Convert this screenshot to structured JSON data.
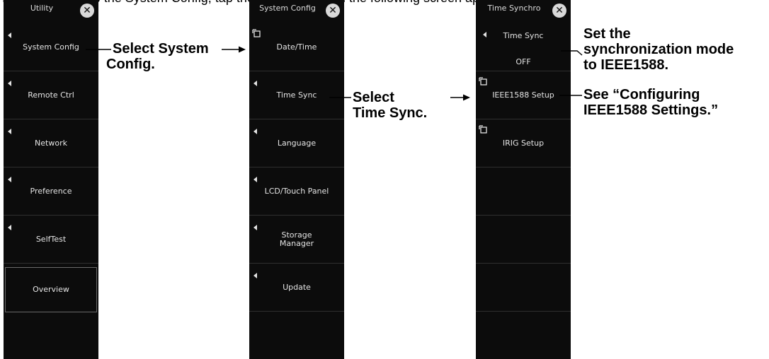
{
  "clipped_top_text": "Tap the Utility, tap the System Config, tap the Time Sync, and the following screen appears.",
  "panels": [
    {
      "title": "Utility",
      "items": [
        {
          "label": "System Config"
        },
        {
          "label": "Remote Ctrl"
        },
        {
          "label": "Network"
        },
        {
          "label": "Preference"
        },
        {
          "label": "SelfTest"
        },
        {
          "label": "Overview"
        }
      ]
    },
    {
      "title": "System Config",
      "items": [
        {
          "label": "Date/Time"
        },
        {
          "label": "Time Sync"
        },
        {
          "label": "Language"
        },
        {
          "label": "LCD/Touch Panel"
        },
        {
          "label_line1": "Storage",
          "label_line2": "Manager"
        },
        {
          "label": "Update"
        }
      ]
    },
    {
      "title": "Time Synchro",
      "items": [
        {
          "label": "Time Sync",
          "value": "OFF"
        },
        {
          "label": "IEEE1588 Setup"
        },
        {
          "label": "IRIG Setup"
        }
      ]
    }
  ],
  "annotations": {
    "select_system_config_line1": "Select System",
    "select_system_config_line2": "Config.",
    "select_time_sync_line1": "Select",
    "select_time_sync_line2": "Time Sync.",
    "set_mode_line1": "Set the",
    "set_mode_line2": "synchronization mode",
    "set_mode_line3": "to IEEE1588.",
    "see_config_line1": "See “Configuring",
    "see_config_line2": "IEEE1588 Settings.”"
  },
  "colors": {
    "panel_bg": "#0c0c0c",
    "panel_text": "#e4e4e4",
    "annotation_text": "#000000"
  }
}
